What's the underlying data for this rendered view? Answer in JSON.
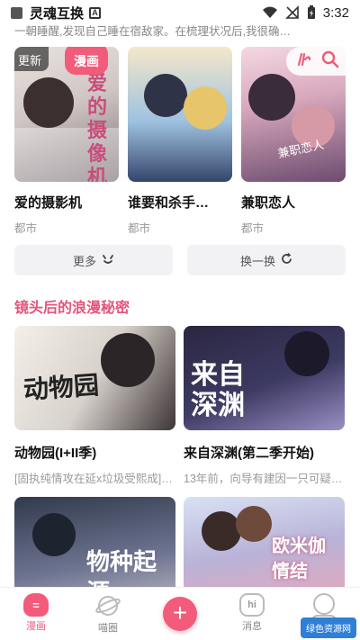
{
  "status_bar": {
    "app_title": "灵魂互换",
    "time": "3:32"
  },
  "header_desc": "一朝睡醒,发现自己睡在宿敌家。在梳理状况后,我很确…",
  "top_row": [
    {
      "title": "爱的摄影机",
      "tag": "都市",
      "badge_new": "更新",
      "badge_comic": "漫画",
      "cover_text": "爱的摄像机"
    },
    {
      "title": "谁要和杀手…",
      "tag": "都市"
    },
    {
      "title": "兼职恋人",
      "tag": "都市",
      "cover_text": "兼职恋人"
    }
  ],
  "float_icons": [
    "editor-icon",
    "search-icon"
  ],
  "buttons": {
    "more_label": "更多",
    "refresh_label": "换一换"
  },
  "section": {
    "title": "镜头后的浪漫秘密",
    "items": [
      {
        "title": "动物园(I+II季)",
        "desc": "[固执纯情攻在延x垃圾受熙成] 宿…",
        "cover_text": "动物园"
      },
      {
        "title": "来自深渊(第二季开始)",
        "desc": "13年前，向导有建因一只可疑…",
        "cover_text": "来自深渊"
      },
      {
        "title": "",
        "desc": "",
        "cover_text": "物种起源"
      },
      {
        "title": "",
        "desc": "",
        "cover_text": "欧米伽情结"
      }
    ]
  },
  "bottom_nav": [
    {
      "label": "漫画",
      "icon": "comic-icon",
      "active": true
    },
    {
      "label": "喵圈",
      "icon": "planet-icon",
      "active": false
    },
    {
      "label": "",
      "icon": "plus-icon",
      "active": false
    },
    {
      "label": "消息",
      "icon": "message-icon",
      "active": false
    },
    {
      "label": "",
      "icon": "profile-icon",
      "active": false
    }
  ],
  "watermark": "绿色资源网",
  "colors": {
    "accent": "#f25b7a",
    "section_title": "#e6537a"
  }
}
